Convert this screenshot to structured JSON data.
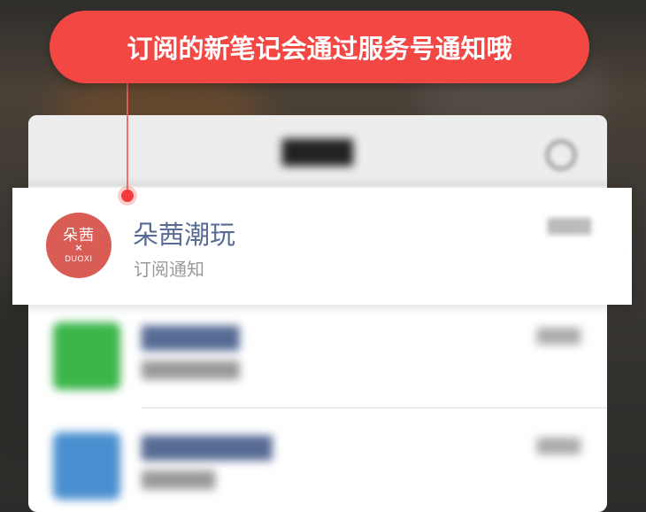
{
  "banner": {
    "text": "订阅的新笔记会通过服务号通知哦"
  },
  "account": {
    "avatar_cn": "朵茜",
    "avatar_x": "×",
    "avatar_en": "DUOXI",
    "name": "朵茜潮玩",
    "subtitle": "订阅通知"
  },
  "colors": {
    "banner_red": "#f24743",
    "link_blue": "#576b95",
    "avatar_red": "#d95d55",
    "wechat_green": "#3bb54a",
    "service_blue": "#4a8fd0"
  }
}
